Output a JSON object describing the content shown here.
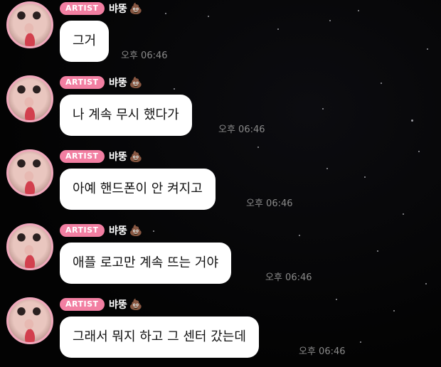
{
  "badge_label": "ARTIST",
  "sender_name": "뱌뚱",
  "sender_emoji": "💩",
  "messages": [
    {
      "text": "그거",
      "time": "오후 06:46"
    },
    {
      "text": "나 계속 무시 했다가",
      "time": "오후 06:46"
    },
    {
      "text": "아예 핸드폰이 안 켜지고",
      "time": "오후 06:46"
    },
    {
      "text": "애플 로고만 계속 뜨는 거야",
      "time": "오후 06:46"
    },
    {
      "text": "그래서 뭐지 하고 그 센터 갔는데",
      "time": "오후 06:46"
    }
  ]
}
